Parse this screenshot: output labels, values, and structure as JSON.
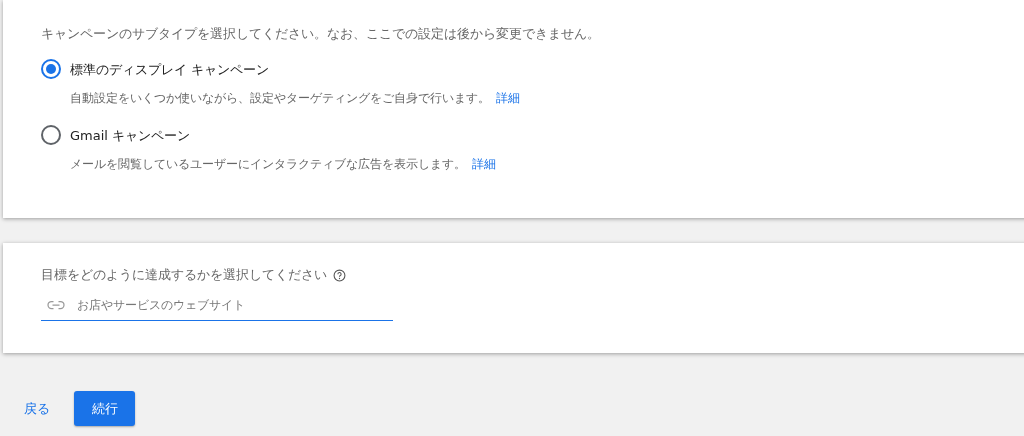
{
  "subtype_card": {
    "instruction": "キャンペーンのサブタイプを選択してください。なお、ここでの設定は後から変更できません。",
    "options": [
      {
        "label": "標準のディスプレイ キャンペーン",
        "description": "自動設定をいくつか使いながら、設定やターゲティングをご自身で行います。",
        "link": "詳細",
        "selected": true
      },
      {
        "label": "Gmail キャンペーン",
        "description": "メールを閲覧しているユーザーにインタラクティブな広告を表示します。",
        "link": "詳細",
        "selected": false
      }
    ]
  },
  "goal_card": {
    "label": "目標をどのように達成するかを選択してください",
    "field": {
      "placeholder": "お店やサービスのウェブサイト"
    }
  },
  "actions": {
    "back": "戻る",
    "continue": "続行"
  }
}
